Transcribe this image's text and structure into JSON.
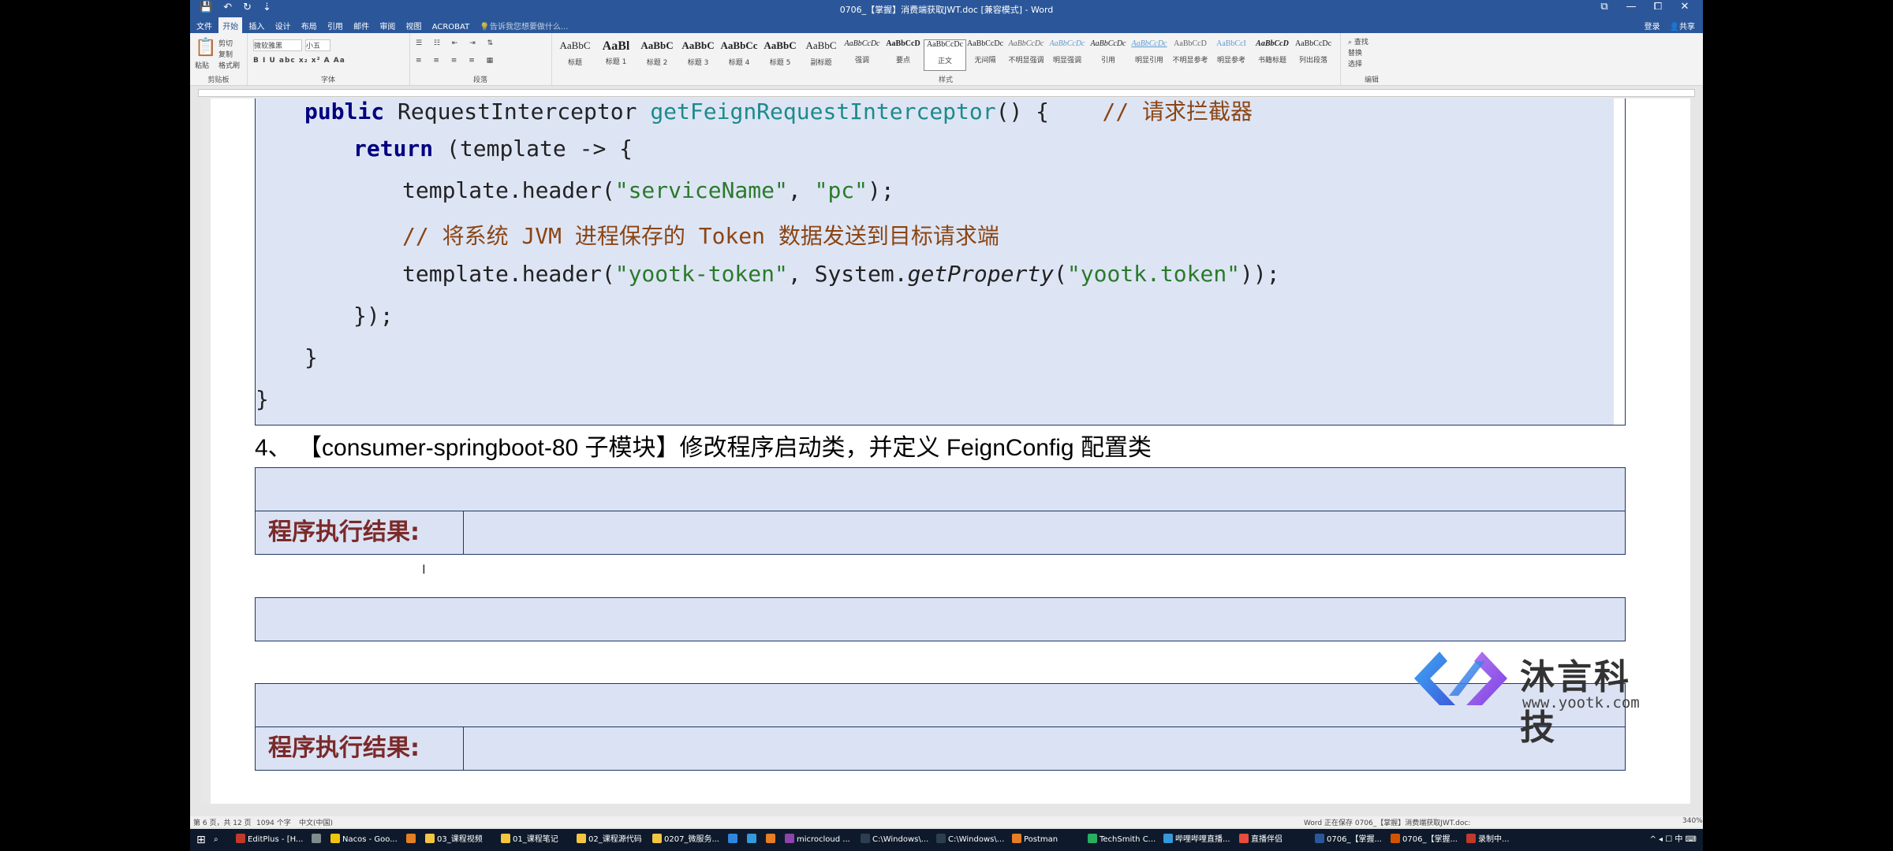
{
  "window": {
    "title": "0706_【掌握】消费端获取JWT.doc [兼容模式] - Word",
    "qat_save": "💾",
    "qat_undo": "↶",
    "qat_redo": "↻",
    "qat_more": "⇣",
    "win_help": "⧉",
    "win_min": "—",
    "win_restore": "⧠",
    "win_close": "✕"
  },
  "ribbon_tabs": {
    "items": [
      "文件",
      "开始",
      "插入",
      "设计",
      "布局",
      "引用",
      "邮件",
      "审阅",
      "视图",
      "ACROBAT"
    ],
    "tell_me": "告诉我您想要做什么...",
    "login": "登录",
    "share": "共享"
  },
  "ribbon": {
    "clipboard": {
      "paste": "粘贴",
      "cut": "剪切",
      "copy": "复制",
      "format_painter": "格式刷",
      "label": "剪贴板"
    },
    "font": {
      "name": "微软雅黑",
      "size": "小五",
      "label": "字体",
      "buttons": "B  I  U  abc  x₂  x²  A  Aa"
    },
    "paragraph": {
      "label": "段落"
    },
    "styles": {
      "label": "样式",
      "items": [
        {
          "preview": "AaBbC",
          "name": "标题"
        },
        {
          "preview": "AaBl",
          "name": "标题 1"
        },
        {
          "preview": "AaBbC",
          "name": "标题 2"
        },
        {
          "preview": "AaBbC",
          "name": "标题 3"
        },
        {
          "preview": "AaBbCc",
          "name": "标题 4"
        },
        {
          "preview": "AaBbC",
          "name": "标题 5"
        },
        {
          "preview": "AaBbC",
          "name": "副标题"
        },
        {
          "preview": "AaBbCcDc",
          "name": "强调"
        },
        {
          "preview": "AaBbCcD",
          "name": "要点"
        },
        {
          "preview": "AaBbCcDc",
          "name": "正文"
        },
        {
          "preview": "AaBbCcDc",
          "name": "无间隔"
        },
        {
          "preview": "AaBbCcDc",
          "name": "不明显强调"
        },
        {
          "preview": "AaBbCcDc",
          "name": "明显强调"
        },
        {
          "preview": "AaBbCcDc",
          "name": "引用"
        },
        {
          "preview": "AaBbCcDc",
          "name": "明显引用"
        },
        {
          "preview": "AaBbCcD",
          "name": "不明显参考"
        },
        {
          "preview": "AaBbCcI",
          "name": "明显参考"
        },
        {
          "preview": "AaBbCcD",
          "name": "书籍标题"
        },
        {
          "preview": "AaBbCcDc",
          "name": "列出段落"
        }
      ]
    },
    "editing": {
      "find": "查找",
      "replace": "替换",
      "select": "选择",
      "label": "编辑"
    }
  },
  "code": {
    "l1_kw": "public",
    "l1_type": " RequestInterceptor ",
    "l1_method": "getFeignRequestInterceptor",
    "l1_rest": "() {    ",
    "l1_comment": "// 请求拦截器",
    "l2_kw": "return",
    "l2_rest": " (template -> {",
    "l3_a": "template.header(",
    "l3_s1": "\"serviceName\"",
    "l3_b": ", ",
    "l3_s2": "\"pc\"",
    "l3_c": ");",
    "l4_comment": "// 将系统 JVM 进程保存的 Token 数据发送到目标请求端",
    "l5_a": "template.header(",
    "l5_s1": "\"yootk-token\"",
    "l5_b": ", System.",
    "l5_m": "getProperty",
    "l5_c": "(",
    "l5_s2": "\"yootk.token\"",
    "l5_d": "));",
    "l6": "});",
    "l7": "}",
    "l8": "}"
  },
  "step4_heading": "4、  【consumer-springboot-80 子模块】修改程序启动类，并定义 FeignConfig 配置类",
  "result_label": "程序执行结果:",
  "logo": {
    "name": "沐言科技",
    "url": "www.yootk.com"
  },
  "status_bar": {
    "page": "第 6 页，共 12 页",
    "words": "1094 个字",
    "lang": "中文(中国)",
    "saving": "Word 正在保存 0706_【掌握】消费端获取JWT.doc:",
    "zoom": "340%"
  },
  "taskbar": {
    "items": [
      {
        "label": "EditPlus - [H...",
        "color": "#c0392b"
      },
      {
        "label": "",
        "color": "#7f8c8d"
      },
      {
        "label": "Nacos - Goo...",
        "color": "#f1c40f"
      },
      {
        "label": "",
        "color": "#e67e22"
      },
      {
        "label": "03_课程视频",
        "color": "#f4c542"
      },
      {
        "label": "01_课程笔记",
        "color": "#f4c542"
      },
      {
        "label": "02_课程源代码",
        "color": "#f4c542"
      },
      {
        "label": "0207_微服务...",
        "color": "#f4c542"
      },
      {
        "label": "",
        "color": "#2e86de"
      },
      {
        "label": "",
        "color": "#3498db"
      },
      {
        "label": "",
        "color": "#e67e22"
      },
      {
        "label": "microcloud ...",
        "color": "#8e44ad"
      },
      {
        "label": "C:\\Windows\\...",
        "color": "#2c3e50"
      },
      {
        "label": "C:\\Windows\\...",
        "color": "#2c3e50"
      },
      {
        "label": "Postman",
        "color": "#e67e22"
      },
      {
        "label": "TechSmith C...",
        "color": "#27ae60"
      },
      {
        "label": "哔哩哔哩直播...",
        "color": "#3498db"
      },
      {
        "label": "直播伴侣",
        "color": "#e74c3c"
      },
      {
        "label": "0706_【掌握...",
        "color": "#2b579a"
      },
      {
        "label": "0706_【掌握...",
        "color": "#d35400"
      },
      {
        "label": "录制中...",
        "color": "#c0392b"
      }
    ],
    "tray": "^ ◂ ☐ 中 ⌨"
  }
}
